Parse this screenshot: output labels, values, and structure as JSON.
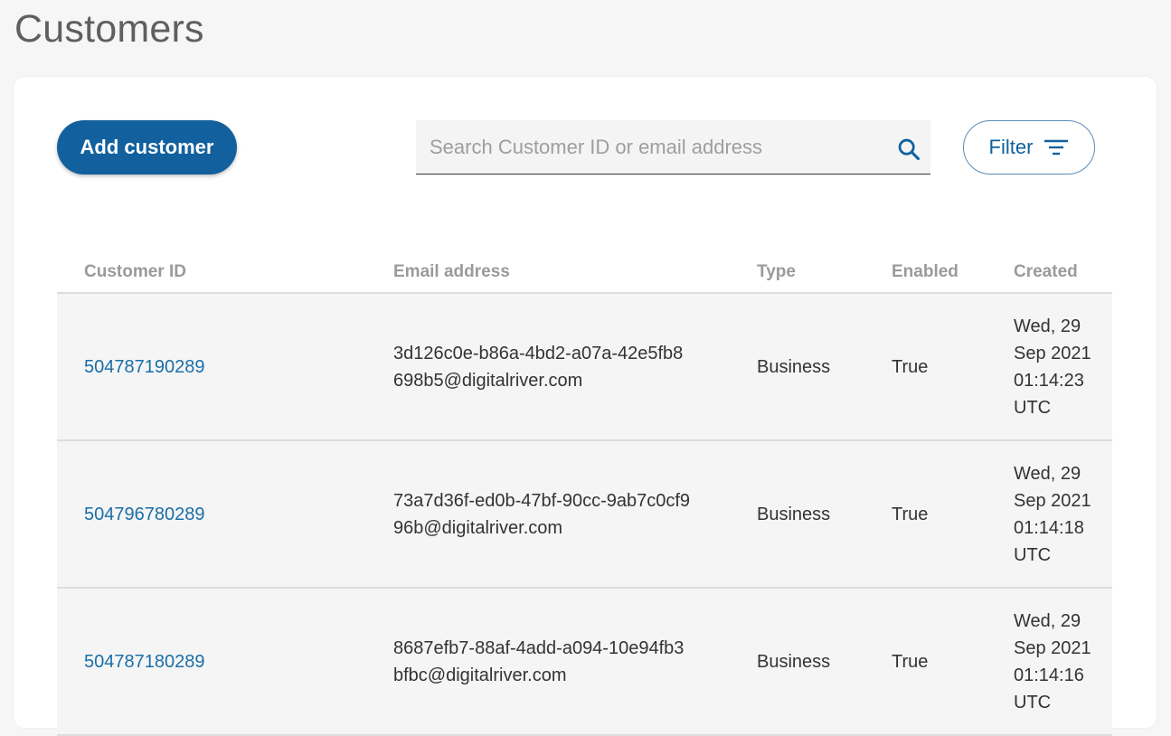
{
  "page": {
    "title": "Customers"
  },
  "toolbar": {
    "add_label": "Add customer",
    "search_placeholder": "Search Customer ID or email address",
    "filter_label": "Filter"
  },
  "colors": {
    "primary": "#12619e",
    "link": "#1a6ea8",
    "row_bg": "#f5f5f5"
  },
  "icons": {
    "search": "search-icon",
    "filter": "filter-lines-icon"
  },
  "table": {
    "headers": [
      "Customer ID",
      "Email address",
      "Type",
      "Enabled",
      "Created"
    ],
    "rows": [
      {
        "id": "504787190289",
        "email": "3d126c0e-b86a-4bd2-a07a-42e5fb8698b5@digitalriver.com",
        "type": "Business",
        "enabled": "True",
        "created": "Wed, 29 Sep 2021 01:14:23 UTC"
      },
      {
        "id": "504796780289",
        "email": "73a7d36f-ed0b-47bf-90cc-9ab7c0cf996b@digitalriver.com",
        "type": "Business",
        "enabled": "True",
        "created": "Wed, 29 Sep 2021 01:14:18 UTC"
      },
      {
        "id": "504787180289",
        "email": "8687efb7-88af-4add-a094-10e94fb3bfbc@digitalriver.com",
        "type": "Business",
        "enabled": "True",
        "created": "Wed, 29 Sep 2021 01:14:16 UTC"
      }
    ]
  }
}
